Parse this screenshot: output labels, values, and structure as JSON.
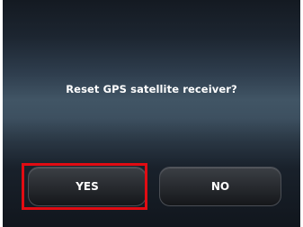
{
  "dialog": {
    "message": "Reset GPS satellite receiver?",
    "yes_label": "YES",
    "no_label": "NO"
  },
  "colors": {
    "highlight": "#e10c13",
    "text": "#ffffff"
  }
}
